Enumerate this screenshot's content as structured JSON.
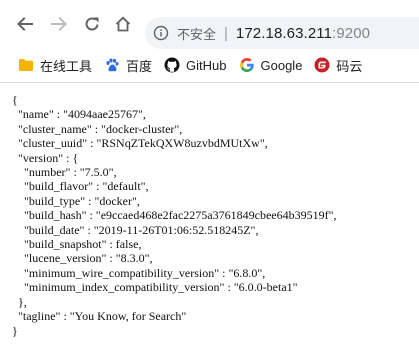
{
  "toolbar": {
    "back": "back",
    "forward": "forward",
    "reload": "reload",
    "home": "home",
    "insecure_label": "不安全",
    "separator": "|",
    "url_host": "172.18.63.211",
    "url_port": ":9200"
  },
  "bookmarks": [
    {
      "label": "在线工具",
      "icon": "folder-icon"
    },
    {
      "label": "百度",
      "icon": "baidu-paw-icon"
    },
    {
      "label": "GitHub",
      "icon": "github-icon"
    },
    {
      "label": "Google",
      "icon": "google-icon"
    },
    {
      "label": "码云",
      "icon": "gitee-icon"
    }
  ],
  "json_lines": [
    "{",
    "  \"name\" : \"4094aae25767\",",
    "  \"cluster_name\" : \"docker-cluster\",",
    "  \"cluster_uuid\" : \"RSNqZTekQXW8uzvbdMUtXw\",",
    "  \"version\" : {",
    "    \"number\" : \"7.5.0\",",
    "    \"build_flavor\" : \"default\",",
    "    \"build_type\" : \"docker\",",
    "    \"build_hash\" : \"e9ccaed468e2fac2275a3761849cbee64b39519f\",",
    "    \"build_date\" : \"2019-11-26T01:06:52.518245Z\",",
    "    \"build_snapshot\" : false,",
    "    \"lucene_version\" : \"8.3.0\",",
    "    \"minimum_wire_compatibility_version\" : \"6.8.0\",",
    "    \"minimum_index_compatibility_version\" : \"6.0.0-beta1\"",
    "  },",
    "  \"tagline\" : \"You Know, for Search\"",
    "}"
  ],
  "colors": {
    "omnibox_bg": "#f1f3f4",
    "text": "#202124",
    "muted": "#5f6368",
    "folder": "#f4b400",
    "baidu": "#2b6de5",
    "gitee": "#c71d23"
  }
}
